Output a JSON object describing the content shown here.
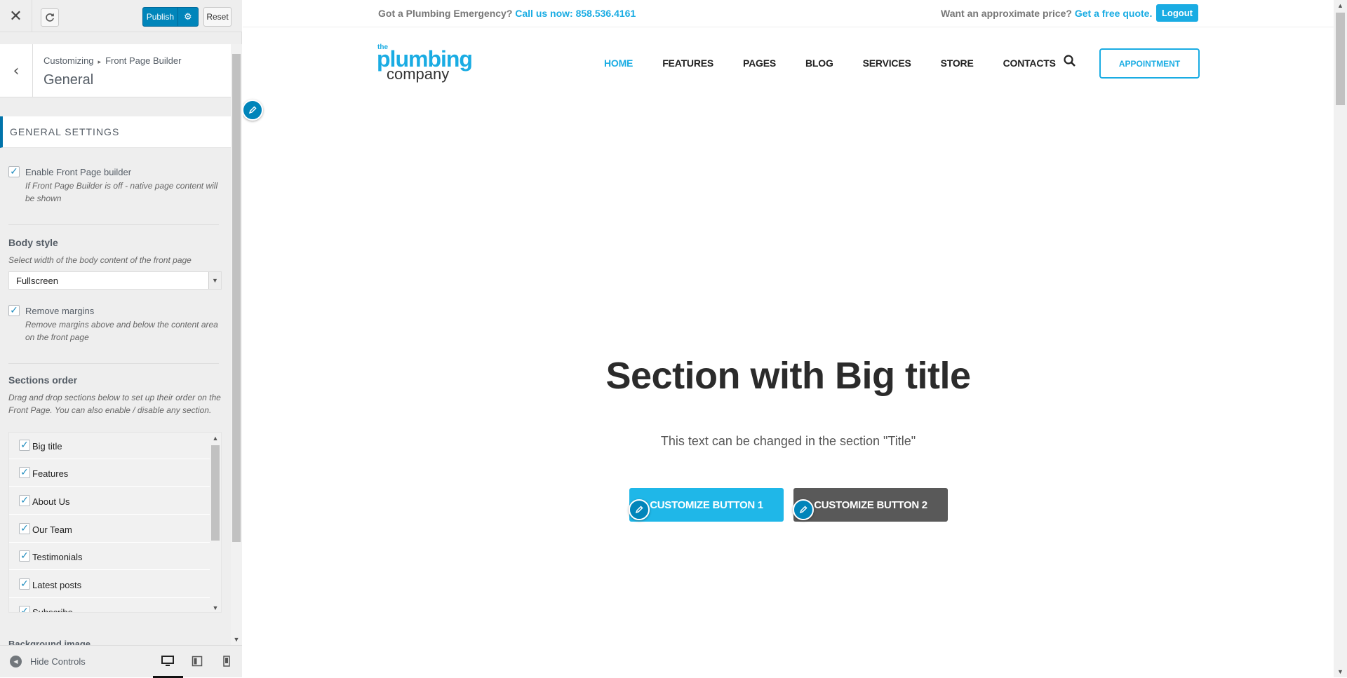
{
  "header": {
    "publish_label": "Publish",
    "reset_label": "Reset"
  },
  "section_title": {
    "breadcrumb_root": "Customizing",
    "breadcrumb_sep": "▸",
    "breadcrumb_parent": "Front Page Builder",
    "title": "General"
  },
  "panel": {
    "group_title": "GENERAL SETTINGS",
    "enable_builder": {
      "label": "Enable Front Page builder",
      "description": "If Front Page Builder is off - native page content will be shown",
      "checked": true
    },
    "body_style": {
      "title": "Body style",
      "description": "Select width of the body content of the front page",
      "selected": "Fullscreen"
    },
    "remove_margins": {
      "label": "Remove margins",
      "description": "Remove margins above and below the content area on the front page",
      "checked": true
    },
    "sections_order": {
      "title": "Sections order",
      "description": "Drag and drop sections below to set up their order on the Front Page. You can also enable / disable any section.",
      "items": [
        {
          "label": "Big title",
          "checked": true
        },
        {
          "label": "Features",
          "checked": true
        },
        {
          "label": "About Us",
          "checked": true
        },
        {
          "label": "Our Team",
          "checked": true
        },
        {
          "label": "Testimonials",
          "checked": true
        },
        {
          "label": "Latest posts",
          "checked": true
        },
        {
          "label": "Subscribe",
          "checked": true
        }
      ]
    },
    "next_control_title": "Background image"
  },
  "footer": {
    "hide_controls_label": "Hide Controls",
    "devices": [
      "desktop-icon",
      "tablet-icon",
      "mobile-icon"
    ],
    "active_device": "desktop"
  },
  "preview": {
    "topbar": {
      "emergency_text": "Got a Plumbing Emergency?",
      "call_text": "Call us now: 858.536.4161",
      "price_text": "Want an approximate price?",
      "quote_link": "Get a free quote.",
      "logout_label": "Logout"
    },
    "logo": {
      "the": "the",
      "plumbing": "plumbing",
      "company": "company"
    },
    "nav": [
      "HOME",
      "FEATURES",
      "PAGES",
      "BLOG",
      "SERVICES",
      "STORE",
      "CONTACTS"
    ],
    "active_nav": "HOME",
    "appointment_label": "APPOINTMENT",
    "hero": {
      "title": "Section with Big title",
      "text": "This text can be changed in the section \"Title\"",
      "button1": "CUSTOMIZE BUTTON 1",
      "button2": "CUSTOMIZE BUTTON 2"
    }
  },
  "colors": {
    "accent": "#1aace3",
    "wp_blue": "#0085ba",
    "button2": "#595959"
  }
}
